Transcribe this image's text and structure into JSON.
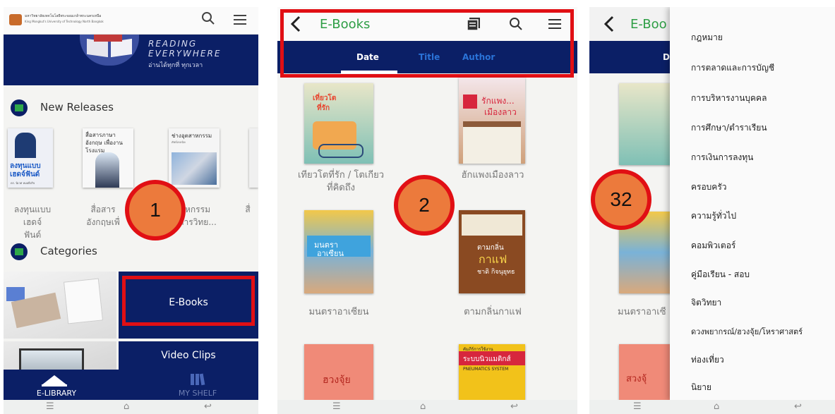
{
  "colors": {
    "navy": "#0b1f66",
    "red": "#e10f14",
    "marker": "#ec7a3c",
    "green": "#2e9e45",
    "link_blue": "#2a73d8"
  },
  "markers": [
    "1",
    "2",
    "32"
  ],
  "p1": {
    "logo_text": "มหาวิทยาลัยเทคโนโลยีพระจอมเกล้าพระนครเหนือ",
    "logo_sub": "King Mongkut's University of Technology North Bangkok",
    "icons": {
      "search": "search-icon",
      "menu": "hamburger-menu-icon"
    },
    "banner": {
      "line1": "READING",
      "line2": "EVERYWHERE",
      "line3": "อ่านได้ทุกที่ ทุกเวลา"
    },
    "new_releases": "New Releases",
    "books": [
      {
        "cover_text": "ลงทุนแบบ เฮดจ์ฟันด์",
        "sub": "ดร. นิเวศ หมอยิ่งกิจ",
        "title_l1": "ลงทุนแบบเฮดจ์",
        "title_l2": "ฟันด์"
      },
      {
        "cover_text": "สื่อสารภาษาอังกฤษ เพื่องานโรงแรม",
        "title_l1": "สื่อสาร",
        "title_l2": "อังกฤษเพื่"
      },
      {
        "cover_text": "ช่างอุตสาหกรรม",
        "sub": "ศัพท์เทคนิค",
        "title_l1": "หกรรม",
        "title_l2": "การวิทย..."
      },
      {
        "title_l1": "สื่"
      }
    ],
    "categories": "Categories",
    "cat_ebooks": "E-Books",
    "cat_video": "Video Clips",
    "tab_elibrary": "E-LIBRARY",
    "tab_myshelf": "MY SHELF"
  },
  "p2": {
    "header_title": "E-Books",
    "tabs": [
      "Date",
      "Title",
      "Author"
    ],
    "books": [
      {
        "cover_l1": "เที่ยวโต",
        "cover_l2": "ที่รัก",
        "title_l1": "เทียวโตที่รัก / โตเกียว",
        "title_l2": "ที่คิดถึง"
      },
      {
        "cover_l1": "รักแพง...",
        "cover_l2": "เมืองลาว",
        "title_l1": "ฮักแพงเมืองลาว"
      },
      {
        "cover_l1": "มนตรา",
        "cover_l2": "อาเซียน",
        "title_l1": "มนตราอาเซียน"
      },
      {
        "cover_l1": "ตามกลิ่น",
        "cover_l2": "กาแฟ",
        "cover_l3": "ชาติ กิจนุยุทธ",
        "title_l1": "ตามกลิ่นกาแฟ"
      },
      {
        "cover_l1": "ฮวงจุ้ย"
      },
      {
        "cover_l1": "คัมภีร์การใช้งาน",
        "cover_l2": "ระบบนิวแมติกส์",
        "cover_l3": "PNEUMATICS SYSTEM"
      }
    ]
  },
  "p3": {
    "header_partial": "E-Boo",
    "tab_partial": "Da",
    "book_partial_l1": "มนตราอาเซี",
    "book_partial_l2": "สวงจุ้",
    "menu": [
      "กฎหมาย",
      "การตลาดและการบัญชี",
      "การบริหารงานบุคคล",
      "การศึกษา/ตำราเรียน",
      "การเงินการลงทุน",
      "ครอบครัว",
      "ความรู้ทั่วไป",
      "คอมพิวเตอร์",
      "คู่มือเรียน - สอบ",
      "จิตวิทยา",
      "ดวงพยากรณ์/ฮวงจุ้ย/โหราศาสตร์",
      "ท่องเที่ยว",
      "นิยาย"
    ]
  }
}
